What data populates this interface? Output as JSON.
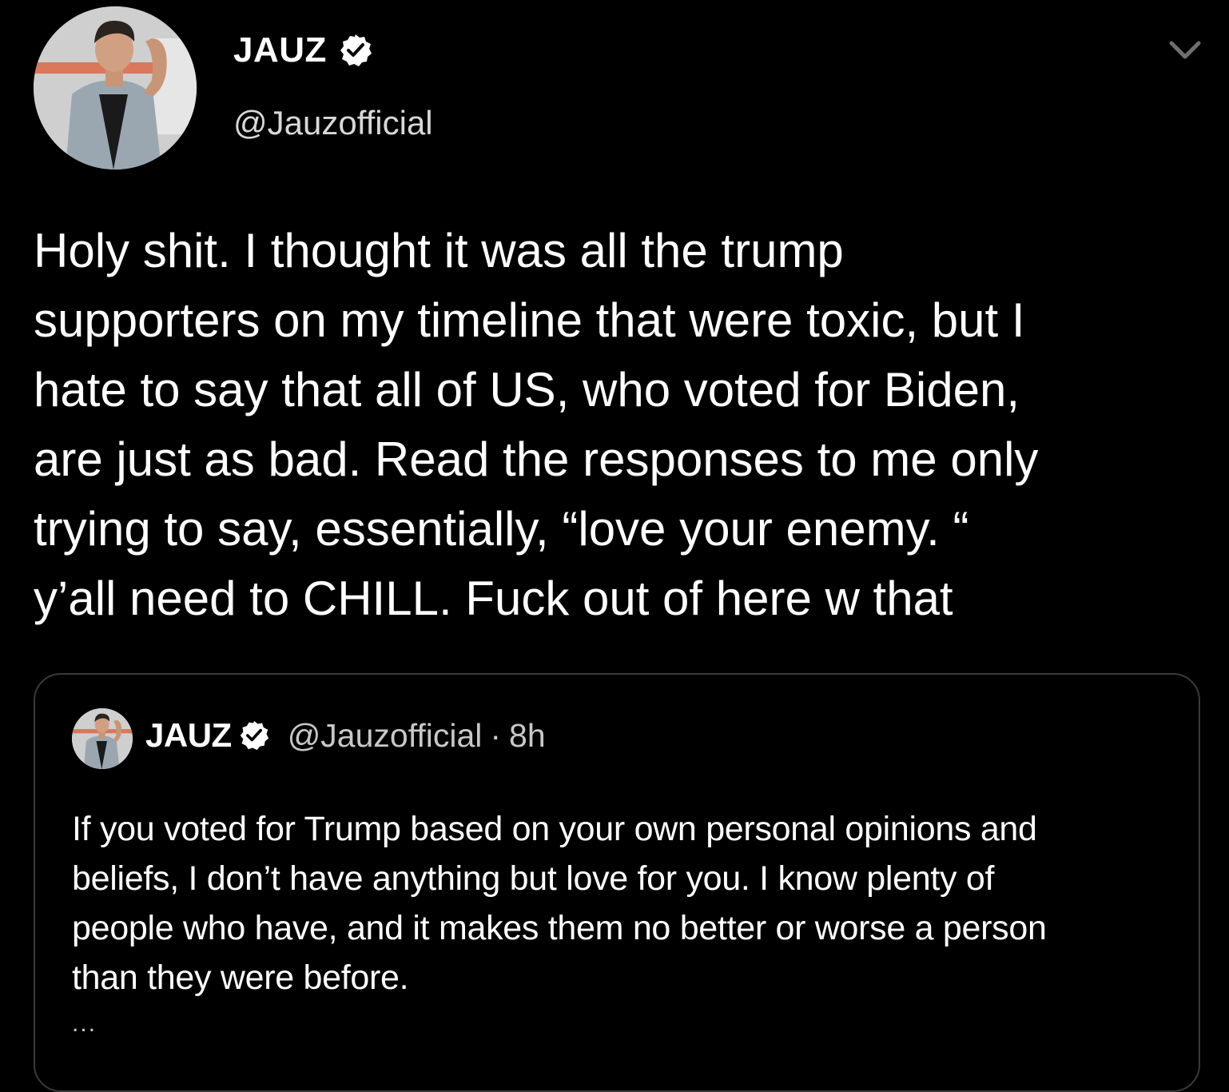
{
  "tweet": {
    "author": {
      "name": "JAUZ",
      "handle": "@Jauzofficial",
      "verified": true
    },
    "text": "Holy shit. I thought it was all the trump\nsupporters on my timeline that were toxic, but I\nhate to say that all of US, who voted for Biden,\nare just as bad. Read the responses to me only\ntrying to say, essentially, “love your enemy. “\ny’all need to CHILL. Fuck out of here w that",
    "menu_icon": "chevron-down-icon"
  },
  "quote": {
    "author": {
      "name": "JAUZ",
      "handle": "@Jauzofficial",
      "verified": true
    },
    "separator": "·",
    "time": "8h",
    "text": "If you voted for Trump based on your own personal opinions and\nbeliefs, I don’t have anything but love for you. I know plenty of\npeople who have, and it makes them no better or worse a person\nthan they were before.",
    "ellipsis": "..."
  },
  "colors": {
    "background": "#000000",
    "text": "#ffffff",
    "secondary_text": "#c8c8c8",
    "border": "#3a3a3a"
  }
}
